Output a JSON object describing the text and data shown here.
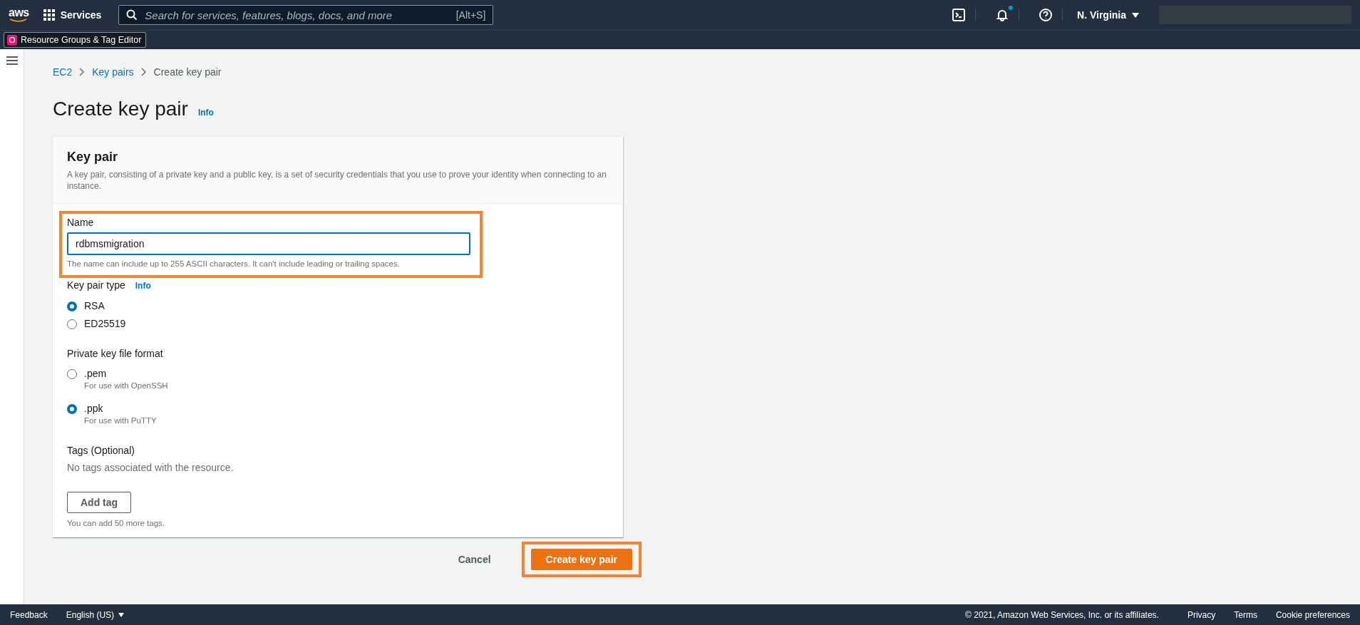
{
  "top_nav": {
    "logo": "aws",
    "services": "Services",
    "search": {
      "placeholder": "Search for services, features, blogs, docs, and more",
      "shortcut": "[Alt+S]"
    },
    "notification_unread": true,
    "region": "N. Virginia"
  },
  "favorites": [
    {
      "label": "Resource Groups & Tag Editor"
    }
  ],
  "breadcrumbs": [
    {
      "label": "EC2",
      "link": true
    },
    {
      "label": "Key pairs",
      "link": true
    },
    {
      "label": "Create key pair",
      "link": false
    }
  ],
  "page": {
    "title": "Create key pair",
    "info": "Info"
  },
  "card": {
    "title": "Key pair",
    "description": "A key pair, consisting of a private key and a public key, is a set of security credentials that you use to prove your identity when connecting to an instance."
  },
  "name_field": {
    "label": "Name",
    "value": "rdbmsmigration",
    "hint": "The name can include up to 255 ASCII characters. It can't include leading or trailing spaces.",
    "highlighted": true
  },
  "key_pair_type": {
    "label": "Key pair type",
    "info": "Info",
    "options": [
      {
        "label": "RSA",
        "selected": true
      },
      {
        "label": "ED25519",
        "selected": false
      }
    ]
  },
  "file_format": {
    "label": "Private key file format",
    "options": [
      {
        "label": ".pem",
        "description": "For use with OpenSSH",
        "selected": false
      },
      {
        "label": ".ppk",
        "description": "For use with PuTTY",
        "selected": true
      }
    ]
  },
  "tags": {
    "label": "Tags (Optional)",
    "empty": "No tags associated with the resource.",
    "add_button": "Add tag",
    "hint": "You can add 50 more tags."
  },
  "actions": [
    {
      "label": "Cancel",
      "kind": "link",
      "highlighted": false
    },
    {
      "label": "Create key pair",
      "kind": "primary",
      "highlighted": true
    }
  ],
  "footer": {
    "left": [
      "Feedback",
      "English (US)"
    ],
    "copyright": "© 2021, Amazon Web Services, Inc. or its affiliates.",
    "links": [
      "Privacy",
      "Terms",
      "Cookie preferences"
    ]
  }
}
